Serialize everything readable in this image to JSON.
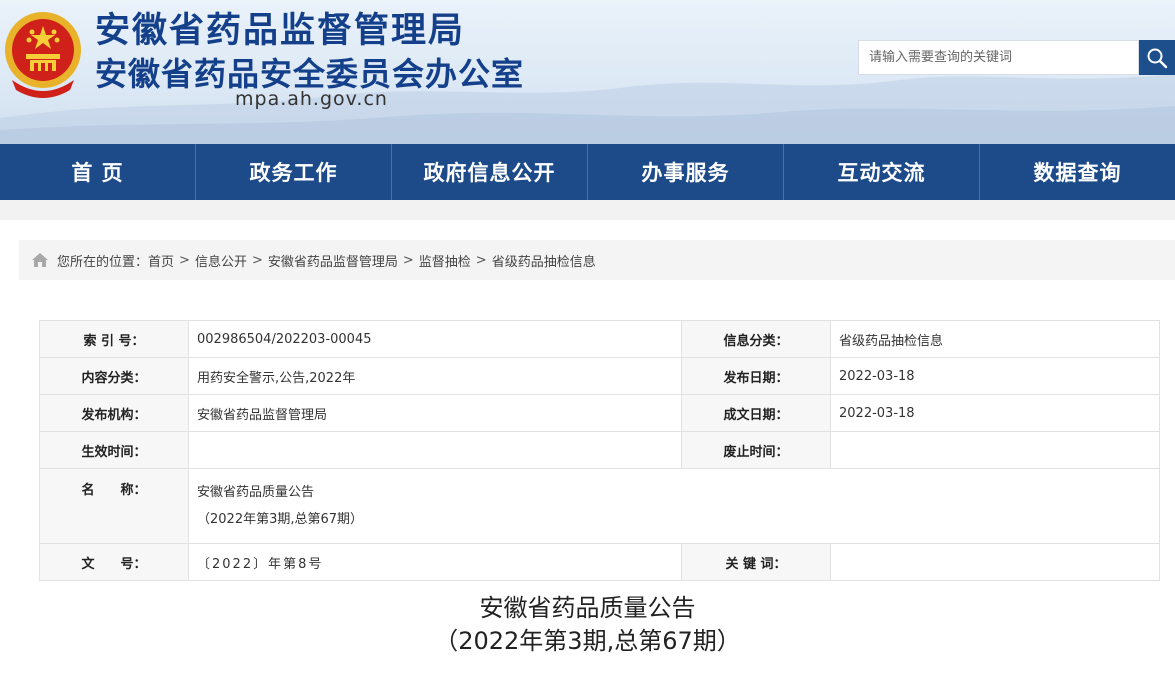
{
  "header": {
    "title_line1": "安徽省药品监督管理局",
    "title_line2": "安徽省药品安全委员会办公室",
    "domain": "mpa.ah.gov.cn",
    "search_placeholder": "请输入需要查询的关键词",
    "brand_color": "#1d4b8a"
  },
  "nav": {
    "items": [
      {
        "label": "首 页"
      },
      {
        "label": "政务工作"
      },
      {
        "label": "政府信息公开"
      },
      {
        "label": "办事服务"
      },
      {
        "label": "互动交流"
      },
      {
        "label": "数据查询"
      }
    ]
  },
  "breadcrumb": {
    "prefix": "您所在的位置：",
    "items": [
      "首页",
      "信息公开",
      "安徽省药品监督管理局",
      "监督抽检",
      "省级药品抽检信息"
    ],
    "separator": ">"
  },
  "info": {
    "index_label": "索 引 号：",
    "index_value": "002986504/202203-00045",
    "category_label": "信息分类：",
    "category_value": "省级药品抽检信息",
    "content_label": "内容分类：",
    "content_value": "用药安全警示,公告,2022年",
    "pubdate_label": "发布日期：",
    "pubdate_value": "2022-03-18",
    "org_label": "发布机构：",
    "org_value": "安徽省药品监督管理局",
    "created_label": "成文日期：",
    "created_value": "2022-03-18",
    "effective_label": "生效时间：",
    "effective_value": "",
    "expire_label": "废止时间：",
    "expire_value": "",
    "name_label": "名　　称：",
    "name_line1": "安徽省药品质量公告",
    "name_line2": "（2022年第3期,总第67期）",
    "docno_label": "文　　号：",
    "docno_value": "〔2022〕年第8号",
    "keywords_label": "关 键 词：",
    "keywords_value": ""
  },
  "article": {
    "title_line1": "安徽省药品质量公告",
    "title_line2": "（2022年第3期,总第67期）"
  }
}
